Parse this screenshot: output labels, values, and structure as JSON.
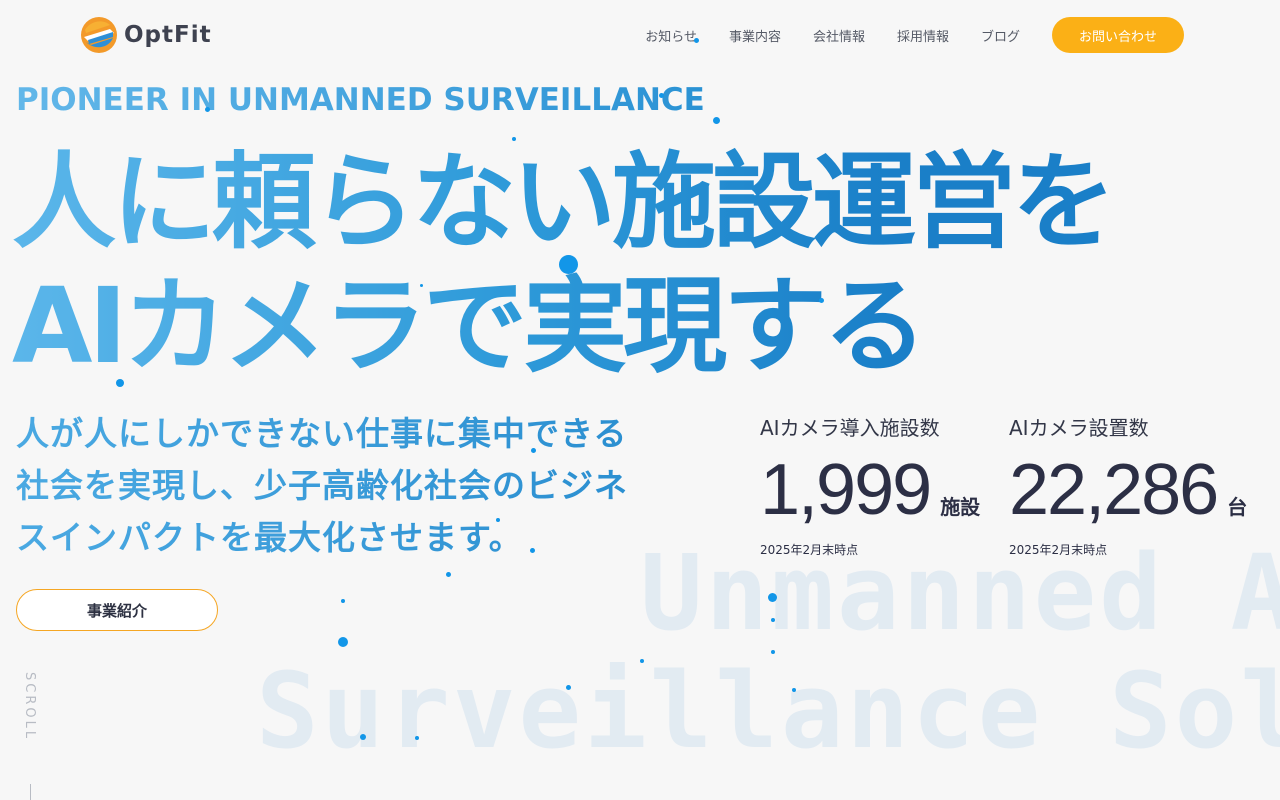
{
  "header": {
    "logo_text": "OptFit",
    "nav": [
      {
        "label": "お知らせ"
      },
      {
        "label": "事業内容"
      },
      {
        "label": "会社情報"
      },
      {
        "label": "採用情報"
      },
      {
        "label": "ブログ"
      }
    ],
    "contact_label": "お問い合わせ"
  },
  "hero": {
    "eyebrow": "PIONEER IN UNMANNED SURVEILLANCE",
    "headline_line1": "人に頼らない施設運営を",
    "headline_line2": "AIカメラで実現する",
    "lead_line1": "人が人にしかできない仕事に集中できる",
    "lead_line2": "社会を実現し、少子高齢化社会のビジネ",
    "lead_line3": "スインパクトを最大化させます。",
    "cta_label": "事業紹介",
    "watermark_line1": "Unmanned AI",
    "watermark_line2": "Surveillance Solution"
  },
  "stats": [
    {
      "label": "AIカメラ導入施設数",
      "value": "1,999",
      "unit": "施設",
      "note": "2025年2月末時点"
    },
    {
      "label": "AIカメラ設置数",
      "value": "22,286",
      "unit": "台",
      "note": "2025年2月末時点"
    }
  ],
  "scroll_label": "SCROLL",
  "colors": {
    "accent_blue": "#2e9ad9",
    "cta_orange": "#fbb016",
    "text_dark": "#2c2f45",
    "background": "#f7f7f7"
  }
}
